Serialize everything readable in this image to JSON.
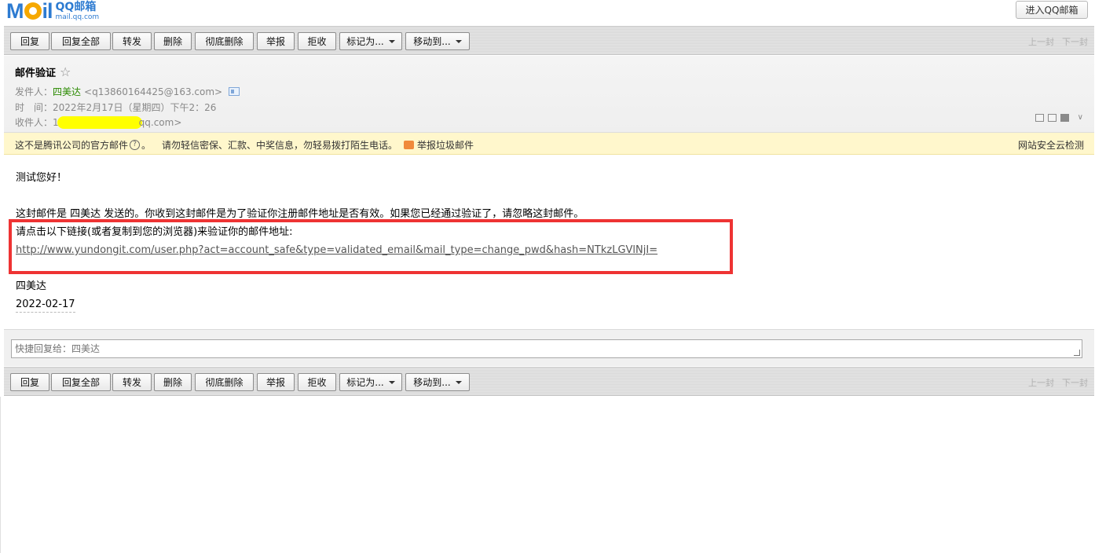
{
  "logo": {
    "mark": "M il",
    "brand": "QQ邮箱",
    "domain": "mail.qq.com"
  },
  "header": {
    "enter_label": "进入QQ邮箱"
  },
  "toolbar": {
    "reply": "回复",
    "reply_all": "回复全部",
    "forward": "转发",
    "delete": "删除",
    "delete_permanently": "彻底删除",
    "report": "举报",
    "reject": "拒收",
    "mark_as": "标记为...",
    "move_to": "移动到...",
    "prev": "上一封",
    "next": "下一封"
  },
  "mail": {
    "subject": "邮件验证",
    "from_label": "发件人：",
    "from_name": "四美达",
    "from_email": "<q13860164425@163.com>",
    "time_label": "时　间：",
    "time_value": "2022年2月17日（星期四）下午2：26",
    "to_label": "收件人：",
    "to_prefix": "1",
    "to_suffix": "qq.com>"
  },
  "warning": {
    "notice": "这不是腾讯公司的官方邮件",
    "notice_end": "。",
    "tip": "请勿轻信密保、汇款、中奖信息，勿轻易拨打陌生电话。",
    "report": "举报垃圾邮件",
    "security": "网站安全云检测"
  },
  "body": {
    "greeting": "测试您好！",
    "line1": "这封邮件是 四美达 发送的。你收到这封邮件是为了验证你注册邮件地址是否有效。如果您已经通过验证了，请忽略这封邮件。",
    "line2": "请点击以下链接(或者复制到您的浏览器)来验证你的邮件地址:",
    "link": "http://www.yundongit.com/user.php?act=account_safe&type=validated_email&mail_type=change_pwd&hash=NTkzLGVlNjI=",
    "signature": "四美达",
    "date": "2022-02-17"
  },
  "quick_reply": {
    "placeholder": "快捷回复给：四美达"
  },
  "colors": {
    "highlight": "#ee3333",
    "sender": "#2a8a00",
    "warning_bg": "#fff7cc",
    "redaction": "#ffff00"
  }
}
